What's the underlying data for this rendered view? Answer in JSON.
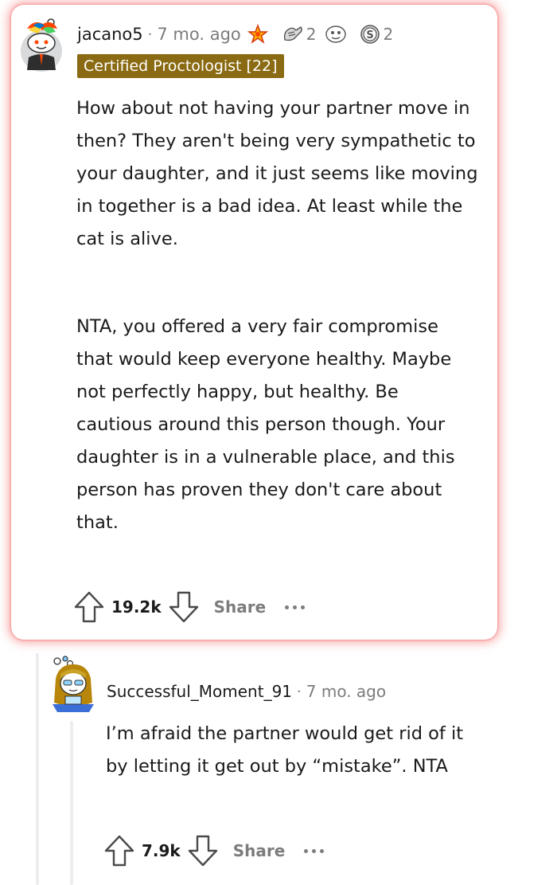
{
  "comments": [
    {
      "username": "jacano5",
      "separator": "·",
      "time": "7 mo. ago",
      "awards": [
        {
          "icon": "star-award-icon",
          "count": ""
        },
        {
          "icon": "hands-award-icon",
          "count": "2"
        },
        {
          "icon": "face-award-icon",
          "count": ""
        },
        {
          "icon": "coin-award-icon",
          "count": "2"
        }
      ],
      "flair": "Certified Proctologist [22]",
      "paragraphs": [
        "How about not having your partner move in then? They aren't being very sympathetic to your daughter, and it just seems like moving in together is a bad idea. At least while the cat is alive.",
        "NTA, you offered a very fair compromise that would keep everyone healthy. Maybe not perfectly happy, but healthy. Be cautious around this person though. Your daughter is in a vulnerable place, and this person has proven they don't care about that."
      ],
      "votes": "19.2k",
      "share_label": "Share"
    },
    {
      "username": "Successful_Moment_91",
      "separator": "·",
      "time": "7 mo. ago",
      "paragraphs": [
        "I’m afraid the partner would get rid of it by letting it get out by “mistake”. NTA"
      ],
      "votes": "7.9k",
      "share_label": "Share"
    }
  ],
  "colors": {
    "highlight_glow": "#f56e6e",
    "flair_bg": "#8a6a12",
    "muted": "#7c7c7c",
    "thread_line": "#ebedef"
  }
}
